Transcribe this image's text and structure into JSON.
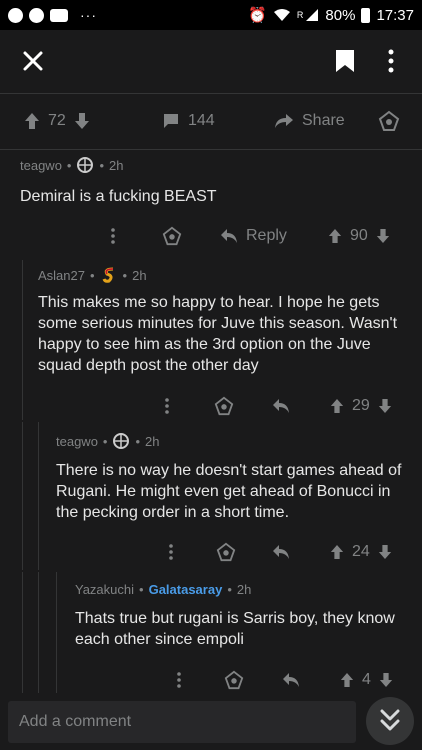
{
  "status": {
    "battery": "80%",
    "time": "17:37",
    "signal_label": "R"
  },
  "post": {
    "score": "72",
    "comment_count": "144",
    "share_label": "Share"
  },
  "comments": [
    {
      "author": "teagwo",
      "time": "2h",
      "body": "Demiral is a fucking BEAST",
      "score": "90",
      "reply_label": "Reply"
    },
    {
      "author": "Aslan27",
      "time": "2h",
      "body": "This makes me so happy to hear. I hope he gets some serious minutes for Juve this season. Wasn't happy to see him as the 3rd option on the Juve squad depth post the other day",
      "score": "29"
    },
    {
      "author": "teagwo",
      "time": "2h",
      "body": "There is no way he doesn't start games ahead of Rugani.  He might even get ahead of Bonucci in the pecking order in a short time.",
      "score": "24"
    },
    {
      "author": "Yazakuchi",
      "flair": "Galatasaray",
      "time": "2h",
      "body": "Thats true but rugani is Sarris boy, they know each other since empoli",
      "score": "4"
    }
  ],
  "separator": "•",
  "composer": {
    "placeholder": "Add a comment"
  },
  "colors": {
    "background": "#1a1a1b",
    "divider": "#343536",
    "muted": "#818384",
    "flair": "#4a9ce8"
  }
}
